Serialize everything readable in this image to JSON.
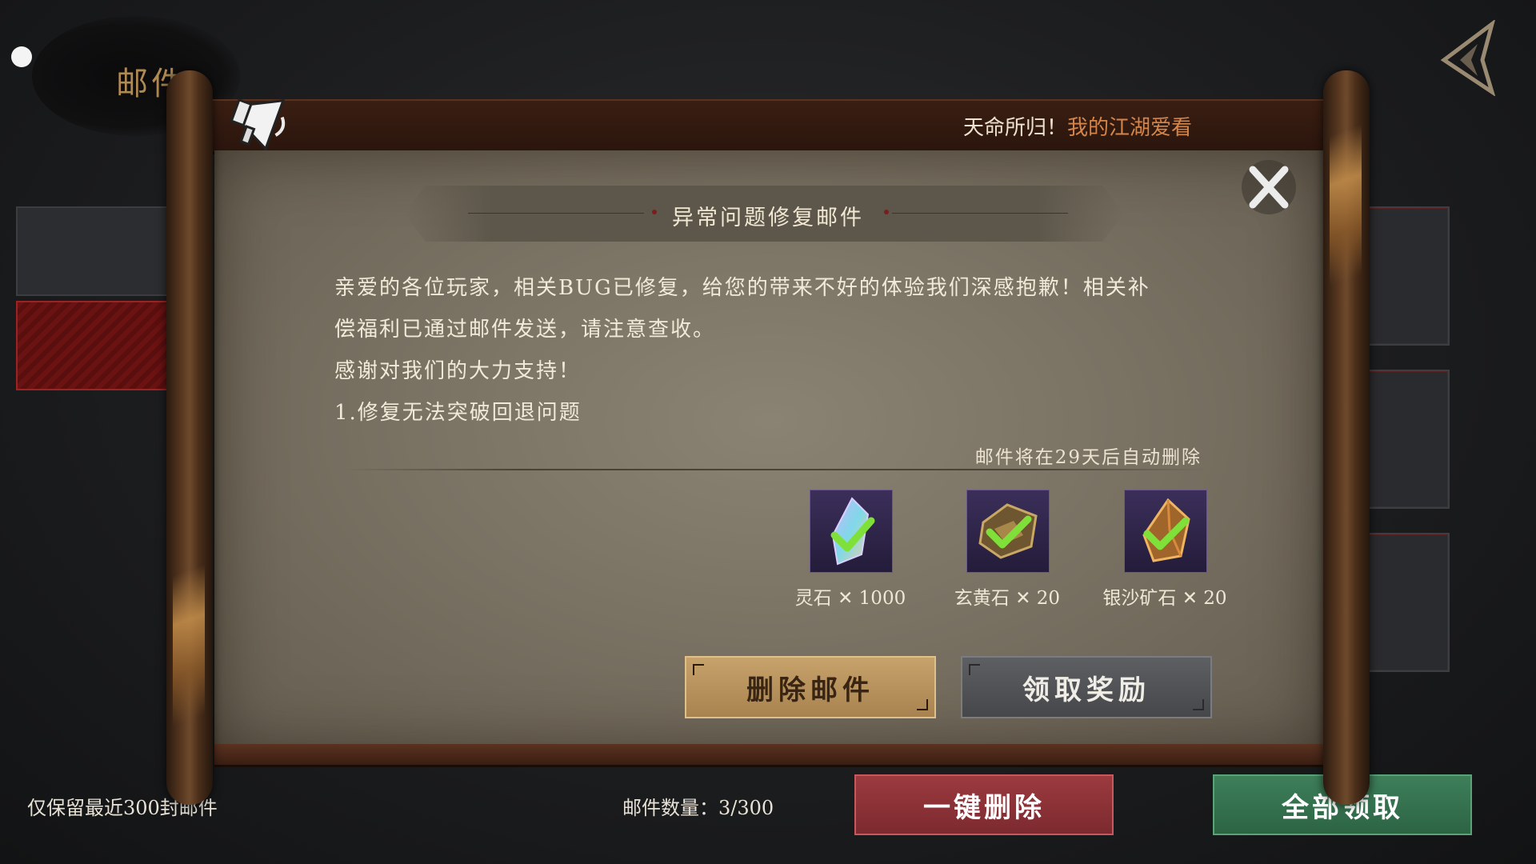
{
  "background": {
    "page_title": "邮件",
    "retention_note": "仅保留最近300封邮件",
    "mail_count": "邮件数量：3/300",
    "delete_all_label": "一键删除",
    "claim_all_label": "全部领取"
  },
  "banner": {
    "text_prefix": "天命所归！",
    "text_highlight": "我的江湖爱看"
  },
  "mail": {
    "title": "异常问题修复邮件",
    "body": [
      "亲爱的各位玩家，相关BUG已修复，给您的带来不好的体验我们深感抱歉！相关补",
      "偿福利已通过邮件发送，请注意查收。",
      "感谢对我们的大力支持！",
      "1.修复无法突破回退问题"
    ],
    "expire_note": "邮件将在29天后自动删除",
    "rewards": [
      {
        "label": "灵石 ✕ 1000",
        "icon": "spirit-stone-icon",
        "claimed": true
      },
      {
        "label": "玄黄石 ✕ 20",
        "icon": "xuanhuang-stone-icon",
        "claimed": true
      },
      {
        "label": "银沙矿石 ✕ 20",
        "icon": "silver-sand-ore-icon",
        "claimed": true
      }
    ],
    "delete_label": "删除邮件",
    "claim_label": "领取奖励"
  },
  "colors": {
    "accent_gold": "#c8a26b",
    "highlight_orange": "#d4854a",
    "delete_all_red": "#9c3a3f",
    "claim_all_green": "#3e7f5a",
    "check_green": "#7fe03a"
  }
}
